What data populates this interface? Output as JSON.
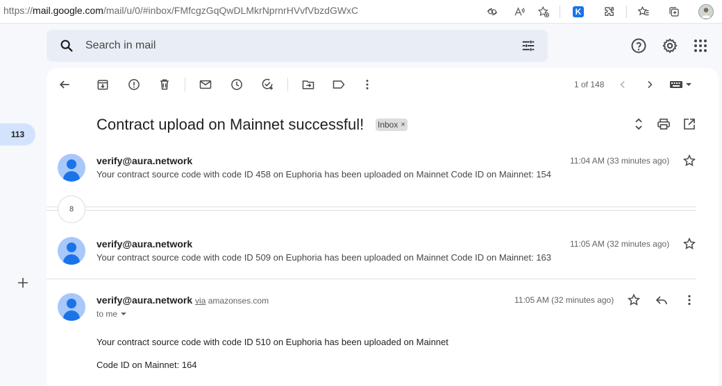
{
  "browser": {
    "url_prefix": "https://",
    "url_host": "mail.google.com",
    "url_rest": "/mail/u/0/#inbox/FMfcgzGqQwDLMkrNprnrHVvfVbzdGWxC",
    "extension_letter": "K"
  },
  "search": {
    "placeholder": "Search in mail"
  },
  "left_rail": {
    "inbox_count": "113"
  },
  "toolbar": {
    "pager": "1 of 148"
  },
  "thread": {
    "subject": "Contract upload on Mainnet successful!",
    "label": "Inbox",
    "label_remove": "×",
    "collapsed_count": "8",
    "messages": [
      {
        "sender": "verify@aura.network",
        "time": "11:04 AM (33 minutes ago)",
        "snippet": "Your contract source code with code ID 458 on Euphoria has been uploaded on Mainnet Code ID on Mainnet: 154"
      },
      {
        "sender": "verify@aura.network",
        "time": "11:05 AM (32 minutes ago)",
        "snippet": "Your contract source code with code ID 509 on Euphoria has been uploaded on Mainnet Code ID on Mainnet: 163"
      },
      {
        "sender": "verify@aura.network",
        "via_label": "via",
        "via_domain": "amazonses.com",
        "time": "11:05 AM (32 minutes ago)",
        "to": "to me",
        "body_line1": "Your contract source code with code ID 510 on Euphoria has been uploaded on Mainnet",
        "body_line2": "Code ID on Mainnet: 164"
      }
    ]
  },
  "colors": {
    "accent": "#1a73e8",
    "badge_bg": "#d3e3fd",
    "search_bg": "#e9eef6",
    "page_bg": "#f6f8fc"
  }
}
